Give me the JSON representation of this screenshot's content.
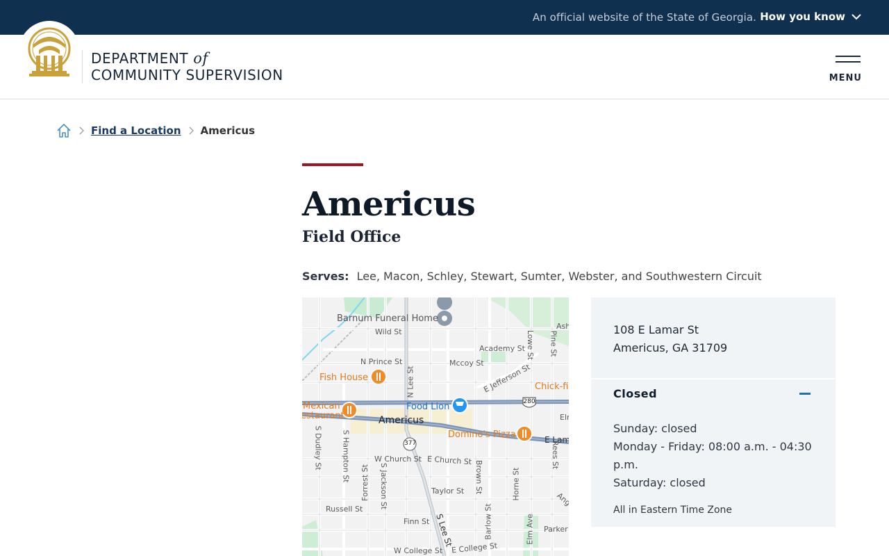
{
  "banner": {
    "official_text": "An official website of the State of Georgia.",
    "how_you_know": "How you know"
  },
  "header": {
    "brand_line1": "DEPARTMENT",
    "brand_of": "of",
    "brand_line2": "COMMUNITY SUPERVISION",
    "menu_label": "MENU"
  },
  "breadcrumb": {
    "link": "Find a Location",
    "current": "Americus"
  },
  "page": {
    "title": "Americus",
    "subtitle": "Field Office",
    "serves_label": "Serves:",
    "serves_value": "Lee, Macon, Schley, Stewart, Sumter, Webster, and Southwestern Circuit"
  },
  "map": {
    "city": "Americus",
    "pois": {
      "barnum": "Barnum Funeral Home",
      "fish_house": "Fish House",
      "food_lion": "Food Lion",
      "chick": "Chick-fil",
      "mexican_1": "Mexican",
      "mexican_2": "estaurant",
      "dominos": "Domino's Pizza"
    },
    "streets": {
      "wild": "Wild St",
      "academy": "Academy St",
      "prince": "N Prince St",
      "mccoy": "Mccoy St",
      "jefferson": "E Jefferson St",
      "nlee": "N Lee St",
      "lowe": "Lowe St",
      "pine": "Pine St",
      "ash": "Ash",
      "elm": "Elm",
      "elamar": "E Lam",
      "wchurch": "W Church St",
      "echurch": "E Church St",
      "dudley": "S Dudley St",
      "hampton": "S Hampton St",
      "forrest": "Forrest St",
      "jackson": "S Jackson St",
      "brown": "Brown St",
      "horne": "Horne St",
      "rees": "Rees St",
      "taylor": "Taylor St",
      "russell": "Russell St",
      "finn": "Finn St",
      "slee": "S Lee St",
      "barlow": "Barlow St",
      "elmave": "Elm Ave",
      "parker": "Parker",
      "wcollege": "W College St",
      "ecollege": "E College St",
      "ang": "Ang"
    },
    "shields": {
      "us280": "280",
      "ga377": "377"
    }
  },
  "location": {
    "address_line1": "108 E Lamar St",
    "address_line2": "Americus, GA 31709",
    "status": "Closed",
    "hours": [
      "Sunday: closed",
      "Monday - Friday: 08:00 a.m. - 04:30 p.m.",
      "Saturday: closed"
    ],
    "timezone_note": "All in Eastern Time Zone"
  },
  "colors": {
    "banner_bg": "#10304f",
    "accent_red": "#a4151b",
    "seal_gold": "#c9a13b",
    "card_bg": "#f1f4f7",
    "link_blue": "#1f6fb8"
  },
  "icons": [
    "chevron-down-icon",
    "seal-logo",
    "menu-icon",
    "home-icon",
    "chevron-right-icon",
    "minus-icon",
    "restaurant-pin-icon",
    "shopping-pin-icon",
    "place-pin-icon"
  ]
}
